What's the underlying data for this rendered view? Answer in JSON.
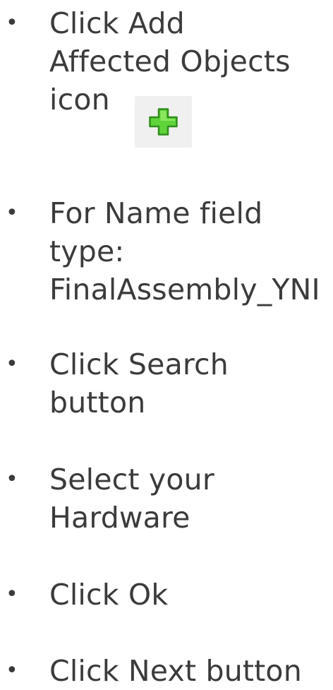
{
  "steps": [
    {
      "lines": [
        "Click Add",
        "Affected Objects",
        "icon"
      ],
      "icon": "add-plus-icon"
    },
    {
      "lines": [
        "For Name field",
        "type:",
        "FinalAssembly_YNI"
      ]
    },
    {
      "lines": [
        "Click Search",
        "button"
      ]
    },
    {
      "lines": [
        "Select your",
        "Hardware"
      ]
    },
    {
      "lines": [
        "Click Ok"
      ]
    },
    {
      "lines": [
        "Click Next button"
      ]
    }
  ],
  "bullet_char": "•",
  "colors": {
    "text": "#3b3b3b",
    "icon_fill": "#5fd43a",
    "icon_stroke": "#2f8e1a",
    "icon_background": "#f0f0f0"
  }
}
